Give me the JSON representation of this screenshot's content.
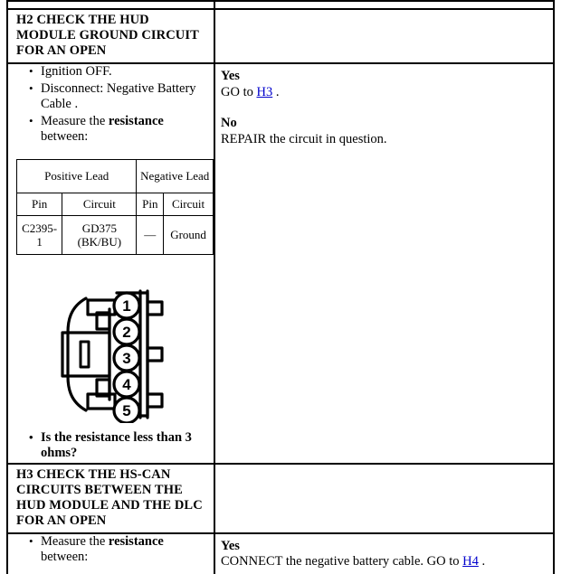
{
  "document": {
    "type": "diagnostic-procedure-table"
  },
  "steps": [
    {
      "id": "h2",
      "heading": "H2 CHECK THE HUD MODULE GROUND CIRCUIT FOR AN OPEN",
      "bullets": [
        {
          "text": "Ignition OFF.",
          "bold": false
        },
        {
          "text": "Disconnect: Negative Battery Cable .",
          "bold": false
        }
      ],
      "measure_bullet": {
        "prefix": "Measure the ",
        "bold_word": "resistance",
        "suffix": " between:"
      },
      "lead_table": {
        "group_headers": {
          "positive": "Positive Lead",
          "negative": "Negative Lead"
        },
        "sub_headers": {
          "pos_pin": "Pin",
          "pos_circuit": "Circuit",
          "neg_pin": "Pin",
          "neg_circuit": "Circuit"
        },
        "rows": [
          {
            "pos_pin": "C2395-1",
            "pos_circuit": "GD375 (BK/BU)",
            "neg_pin": "—",
            "neg_circuit": "Ground"
          }
        ]
      },
      "connector": {
        "name": "5-pin-connector-diagram",
        "pins": [
          "1",
          "2",
          "3",
          "4",
          "5"
        ]
      },
      "question": "Is the resistance less than 3 ohms?",
      "answers": [
        {
          "label": "Yes",
          "prefix": "GO to ",
          "link": "H3",
          "suffix": " ."
        },
        {
          "label": "No",
          "prefix": "REPAIR the circuit in question.",
          "link": "",
          "suffix": ""
        }
      ]
    },
    {
      "id": "h3",
      "heading": "H3 CHECK THE HS-CAN CIRCUITS BETWEEN THE HUD MODULE AND THE DLC FOR AN OPEN",
      "measure_bullet": {
        "prefix": "Measure the ",
        "bold_word": "resistance",
        "suffix": " between:"
      },
      "answers": [
        {
          "label": "Yes",
          "prefix": "CONNECT the negative battery cable. GO to ",
          "link": "H4",
          "suffix": " ."
        }
      ]
    }
  ],
  "colors": {
    "link": "#0000cc",
    "border": "#000000",
    "background": "#ffffff"
  }
}
